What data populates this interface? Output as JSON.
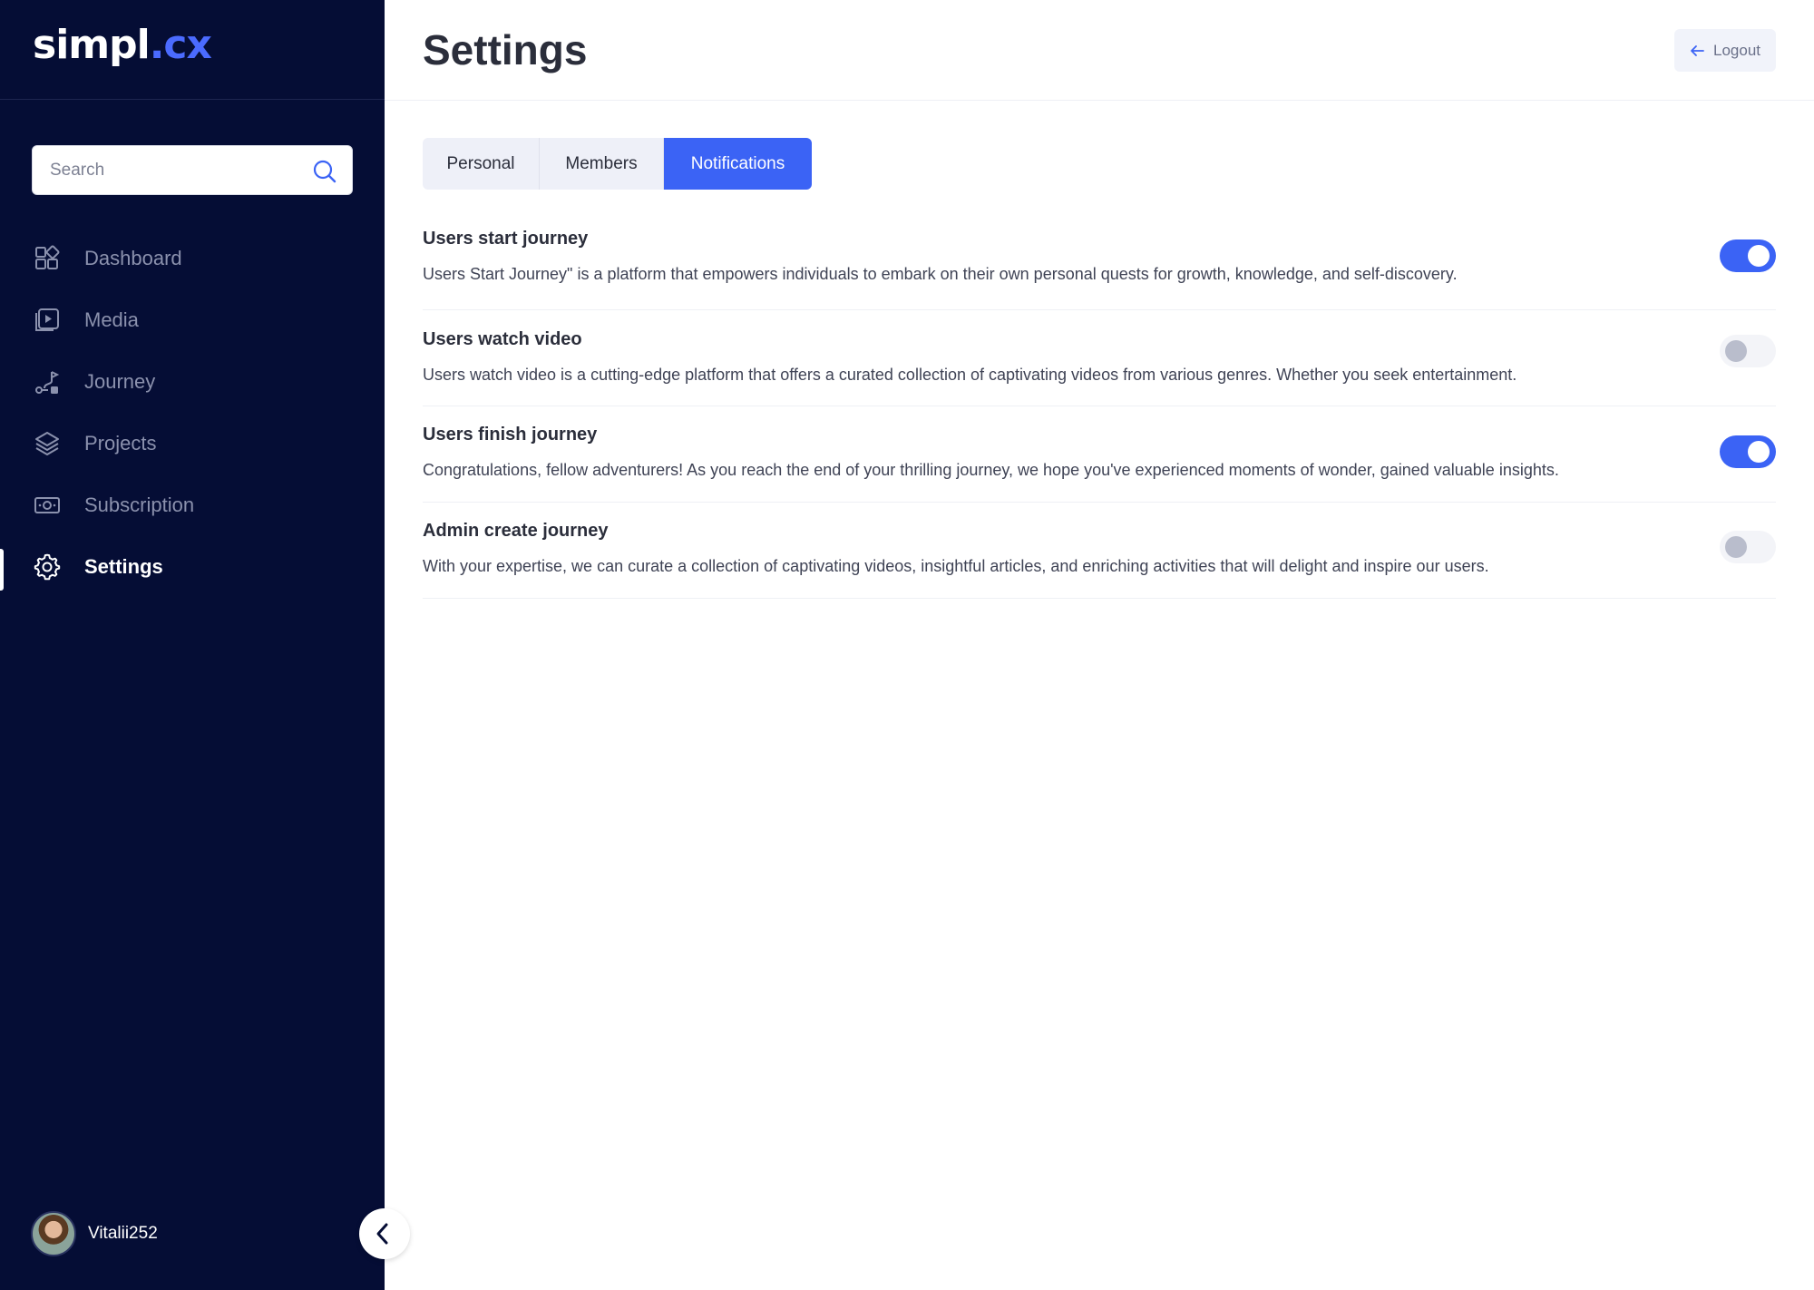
{
  "brand": {
    "logo_part1": "simpl",
    "logo_part2": ".cx"
  },
  "search": {
    "placeholder": "Search"
  },
  "sidebar": {
    "items": [
      {
        "label": "Dashboard",
        "icon": "dashboard-icon"
      },
      {
        "label": "Media",
        "icon": "media-play-icon"
      },
      {
        "label": "Journey",
        "icon": "journey-route-icon"
      },
      {
        "label": "Projects",
        "icon": "layers-icon"
      },
      {
        "label": "Subscription",
        "icon": "money-icon"
      },
      {
        "label": "Settings",
        "icon": "gear-icon",
        "active": true
      }
    ]
  },
  "user": {
    "name": "Vitalii252"
  },
  "header": {
    "title": "Settings",
    "logout_label": "Logout"
  },
  "tabs": [
    {
      "label": "Personal"
    },
    {
      "label": "Members"
    },
    {
      "label": "Notifications",
      "active": true
    }
  ],
  "notifications": [
    {
      "title": "Users start journey",
      "description": "Users Start Journey\" is a platform that empowers individuals to embark on their own personal quests for growth, knowledge, and self-discovery.",
      "enabled": true
    },
    {
      "title": "Users watch video",
      "description": "Users watch video is a cutting-edge platform that offers a curated collection of captivating videos from various genres. Whether you seek entertainment.",
      "enabled": false
    },
    {
      "title": "Users finish journey",
      "description": "Congratulations, fellow adventurers! As you reach the end of your thrilling journey, we hope you've experienced moments of wonder, gained valuable insights.",
      "enabled": true
    },
    {
      "title": "Admin create journey",
      "description": "With your expertise, we can curate a collection of captivating videos, insightful articles, and enriching activities that will delight and inspire our users.",
      "enabled": false
    }
  ],
  "colors": {
    "sidebar_bg": "#050d35",
    "accent": "#3b63f5",
    "logo_accent": "#4b6bff"
  }
}
